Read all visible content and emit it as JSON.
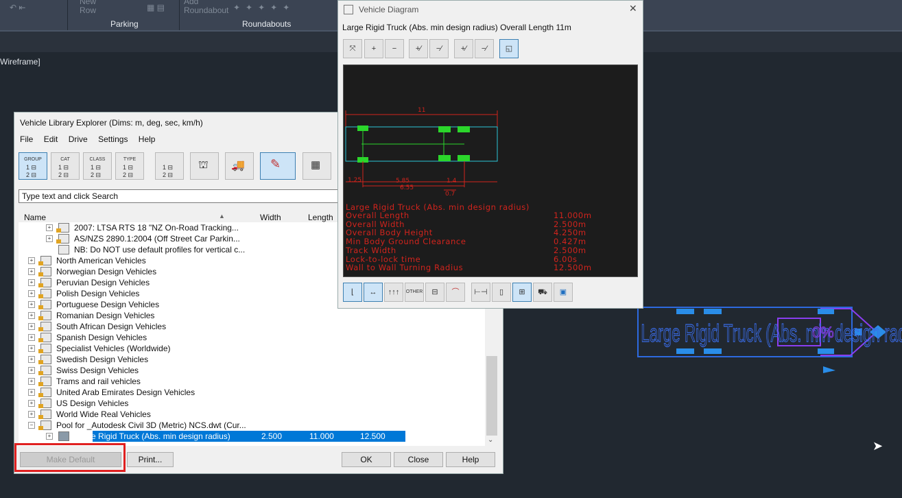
{
  "ribbon": {
    "new_row": "New\nRow",
    "add_roundabout": "Add\nRoundabout",
    "panels": [
      "Parking",
      "Roundabouts"
    ]
  },
  "viewport_label": "Wireframe]",
  "vle": {
    "title": "Vehicle Library Explorer    (Dims: m, deg, sec, km/h)",
    "menu": [
      "File",
      "Edit",
      "Drive",
      "Settings",
      "Help"
    ],
    "toolbar": [
      {
        "cap": "GROUP",
        "icon": "group-icon"
      },
      {
        "cap": "CAT",
        "icon": "category-icon"
      },
      {
        "cap": "CLASS",
        "icon": "class-icon"
      },
      {
        "cap": "TYPE",
        "icon": "type-icon"
      }
    ],
    "search_placeholder": "Type text and click Search",
    "columns": {
      "name": "Name",
      "width": "Width",
      "length": "Length"
    },
    "tree": [
      {
        "label": "2007: LTSA RTS 18 \"NZ On-Road Tracking...",
        "level": 2,
        "type": "doc"
      },
      {
        "label": "AS/NZS 2890.1:2004 (Off Street Car Parkin...",
        "level": 2,
        "type": "doc"
      },
      {
        "label": "NB: Do NOT use default profiles for vertical c...",
        "level": 2,
        "type": "note"
      },
      {
        "label": "North American Vehicles",
        "level": 1
      },
      {
        "label": "Norwegian Design Vehicles",
        "level": 1
      },
      {
        "label": "Peruvian Design Vehicles",
        "level": 1
      },
      {
        "label": "Polish Design Vehicles",
        "level": 1
      },
      {
        "label": "Portuguese Design Vehicles",
        "level": 1
      },
      {
        "label": "Romanian Design Vehicles",
        "level": 1
      },
      {
        "label": "South African Design Vehicles",
        "level": 1
      },
      {
        "label": "Spanish Design Vehicles",
        "level": 1
      },
      {
        "label": "Specialist Vehicles (Worldwide)",
        "level": 1
      },
      {
        "label": "Swedish Design Vehicles",
        "level": 1
      },
      {
        "label": "Swiss Design Vehicles",
        "level": 1
      },
      {
        "label": "Trams and rail vehicles",
        "level": 1
      },
      {
        "label": "United Arab Emirates Design Vehicles",
        "level": 1
      },
      {
        "label": "US Design Vehicles",
        "level": 1
      },
      {
        "label": "World Wide Real Vehicles",
        "level": 1
      },
      {
        "label": "Pool for _Autodesk Civil 3D (Metric) NCS.dwt (Cur...",
        "level": 1,
        "type": "pool"
      }
    ],
    "selected": {
      "label": "Large Rigid Truck (Abs. min design radius)",
      "width": "2.500",
      "length": "11.000",
      "extra": "12.500"
    },
    "buttons": {
      "make_default": "Make Default",
      "print": "Print...",
      "ok": "OK",
      "close": "Close",
      "help": "Help"
    }
  },
  "vd": {
    "title": "Vehicle Diagram",
    "subtitle": "Large Rigid Truck (Abs. min design radius)    Overall Length  11m",
    "dims": {
      "top": "11",
      "a": "1.25",
      "b": "5.85",
      "c": "6.55",
      "d": "1.4",
      "e": "0.7"
    },
    "specs_title": "Large Rigid Truck (Abs. min design radius)",
    "specs": [
      {
        "k": "Overall Length",
        "v": "11.000m"
      },
      {
        "k": "Overall Width",
        "v": "2.500m"
      },
      {
        "k": "Overall Body Height",
        "v": "4.250m"
      },
      {
        "k": "Min Body Ground Clearance",
        "v": "0.427m"
      },
      {
        "k": "Track Width",
        "v": "2.500m"
      },
      {
        "k": "Lock-to-lock time",
        "v": "6.00s"
      },
      {
        "k": "Wall to Wall Turning Radius",
        "v": "12.500m"
      }
    ],
    "other_label": "OTHER"
  },
  "drawing_label": "Large Rigid Truck (Abs. min design radius)",
  "drawing_pct": "0%"
}
